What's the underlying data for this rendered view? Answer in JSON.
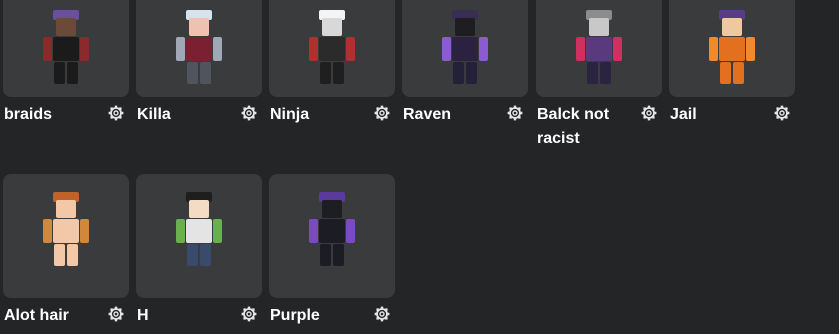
{
  "outfits": [
    {
      "name": "braids",
      "settings_icon": "gear-icon",
      "colors": {
        "head": "#6b4a3a",
        "hat": "#6a4ea0",
        "body": "#1b1b1b",
        "accent": "#8b2a2a",
        "legs": "#1b1b1b"
      }
    },
    {
      "name": "Killa",
      "settings_icon": "gear-icon",
      "colors": {
        "head": "#f0c0b0",
        "hat": "#d7e3ec",
        "body": "#7a2030",
        "accent": "#a0a8b8",
        "legs": "#50545c"
      }
    },
    {
      "name": "Ninja",
      "settings_icon": "gear-icon",
      "colors": {
        "head": "#d8d8d8",
        "hat": "#f4f4f4",
        "body": "#2b2b2b",
        "accent": "#b03030",
        "legs": "#1f1f1f"
      }
    },
    {
      "name": "Raven",
      "settings_icon": "gear-icon",
      "colors": {
        "head": "#1e1e22",
        "hat": "#3a2d52",
        "body": "#2a2240",
        "accent": "#8a5cd0",
        "legs": "#24203a"
      }
    },
    {
      "name": "Balck not racist",
      "settings_icon": "gear-icon",
      "colors": {
        "head": "#c8c8c8",
        "hat": "#8c8c8c",
        "body": "#5a3a7c",
        "accent": "#d03060",
        "legs": "#2a2440"
      }
    },
    {
      "name": "Jail",
      "settings_icon": "gear-icon",
      "colors": {
        "head": "#f0c8a0",
        "hat": "#5a3a8a",
        "body": "#e2701e",
        "accent": "#f08a2a",
        "legs": "#e2701e"
      }
    },
    {
      "name": "Alot hair",
      "settings_icon": "gear-icon",
      "colors": {
        "head": "#f2c8a8",
        "hat": "#c0622a",
        "body": "#f2c8a8",
        "accent": "#d0883a",
        "legs": "#f2c8a8"
      }
    },
    {
      "name": "H",
      "settings_icon": "gear-icon",
      "colors": {
        "head": "#f4dcc4",
        "hat": "#1e1e1e",
        "body": "#e4e4e4",
        "accent": "#6ab04c",
        "legs": "#3a4a6a"
      }
    },
    {
      "name": "Purple",
      "settings_icon": "gear-icon",
      "colors": {
        "head": "#1e1e22",
        "hat": "#5a3a9a",
        "body": "#1c1c24",
        "accent": "#7a4ac0",
        "legs": "#1c1c24"
      }
    }
  ]
}
